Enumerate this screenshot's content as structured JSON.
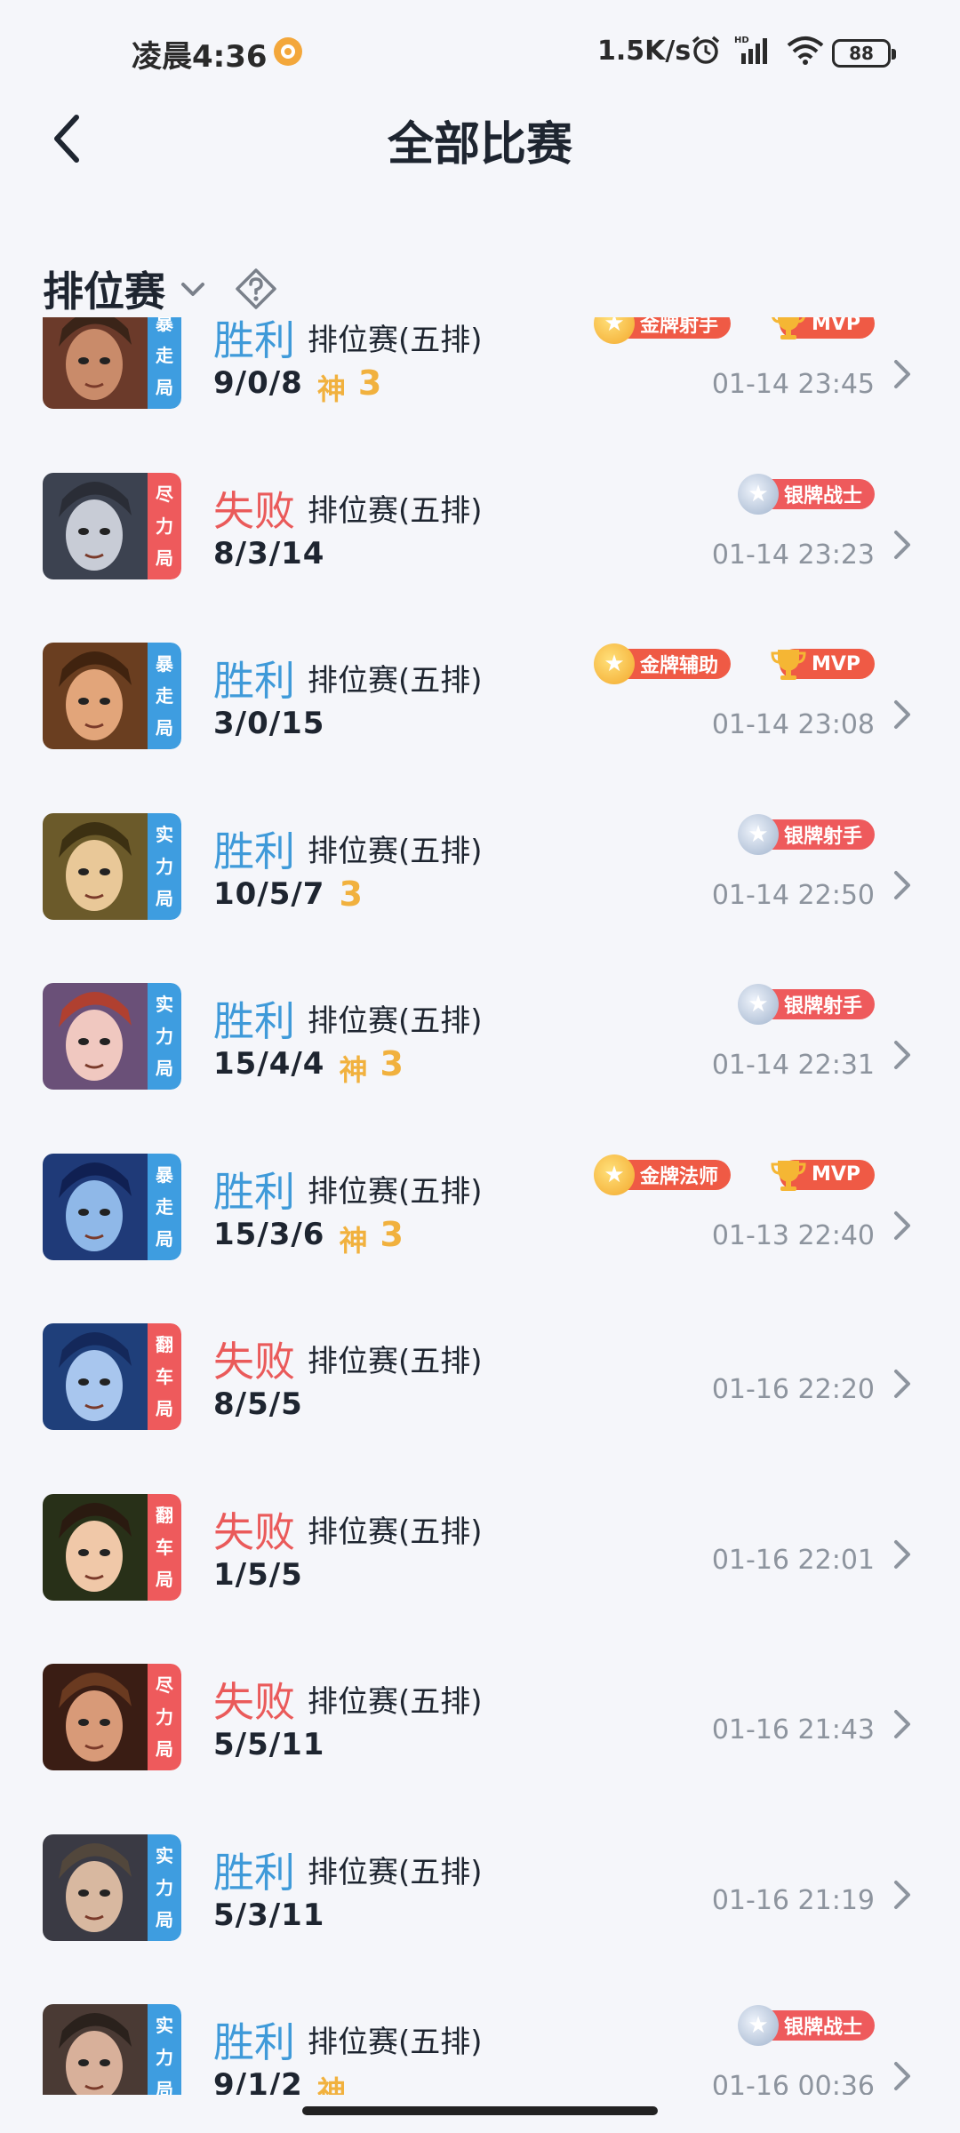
{
  "status_bar": {
    "time": "凌晨4:36",
    "net_speed": "1.5K/s",
    "battery": "88"
  },
  "header": {
    "title": "全部比赛"
  },
  "filter": {
    "label": "排位赛"
  },
  "matches": [
    {
      "result": "胜利",
      "outcome": "win",
      "mode": "排位赛(五排)",
      "kda": "9/0/8",
      "shen": "神",
      "three": "3",
      "time": "01-14 23:45",
      "tag": [
        "暴",
        "走",
        "局"
      ],
      "tag_color": "blue",
      "medal": "金牌射手",
      "medal_type": "gold",
      "mvp": "MVP"
    },
    {
      "result": "失败",
      "outcome": "lose",
      "mode": "排位赛(五排)",
      "kda": "8/3/14",
      "shen": "",
      "three": "",
      "time": "01-14 23:23",
      "tag": [
        "尽",
        "力",
        "局"
      ],
      "tag_color": "red",
      "medal": "银牌战士",
      "medal_type": "silver",
      "mvp": ""
    },
    {
      "result": "胜利",
      "outcome": "win",
      "mode": "排位赛(五排)",
      "kda": "3/0/15",
      "shen": "",
      "three": "",
      "time": "01-14 23:08",
      "tag": [
        "暴",
        "走",
        "局"
      ],
      "tag_color": "blue",
      "medal": "金牌辅助",
      "medal_type": "gold",
      "mvp": "MVP"
    },
    {
      "result": "胜利",
      "outcome": "win",
      "mode": "排位赛(五排)",
      "kda": "10/5/7",
      "shen": "",
      "three": "3",
      "time": "01-14 22:50",
      "tag": [
        "实",
        "力",
        "局"
      ],
      "tag_color": "blue",
      "medal": "银牌射手",
      "medal_type": "silver",
      "mvp": ""
    },
    {
      "result": "胜利",
      "outcome": "win",
      "mode": "排位赛(五排)",
      "kda": "15/4/4",
      "shen": "神",
      "three": "3",
      "time": "01-14 22:31",
      "tag": [
        "实",
        "力",
        "局"
      ],
      "tag_color": "blue",
      "medal": "银牌射手",
      "medal_type": "silver",
      "mvp": ""
    },
    {
      "result": "胜利",
      "outcome": "win",
      "mode": "排位赛(五排)",
      "kda": "15/3/6",
      "shen": "神",
      "three": "3",
      "time": "01-13 22:40",
      "tag": [
        "暴",
        "走",
        "局"
      ],
      "tag_color": "blue",
      "medal": "金牌法师",
      "medal_type": "gold",
      "mvp": "MVP"
    },
    {
      "result": "失败",
      "outcome": "lose",
      "mode": "排位赛(五排)",
      "kda": "8/5/5",
      "shen": "",
      "three": "",
      "time": "01-16 22:20",
      "tag": [
        "翻",
        "车",
        "局"
      ],
      "tag_color": "red",
      "medal": "",
      "medal_type": "",
      "mvp": ""
    },
    {
      "result": "失败",
      "outcome": "lose",
      "mode": "排位赛(五排)",
      "kda": "1/5/5",
      "shen": "",
      "three": "",
      "time": "01-16 22:01",
      "tag": [
        "翻",
        "车",
        "局"
      ],
      "tag_color": "red",
      "medal": "",
      "medal_type": "",
      "mvp": ""
    },
    {
      "result": "失败",
      "outcome": "lose",
      "mode": "排位赛(五排)",
      "kda": "5/5/11",
      "shen": "",
      "three": "",
      "time": "01-16 21:43",
      "tag": [
        "尽",
        "力",
        "局"
      ],
      "tag_color": "red",
      "medal": "",
      "medal_type": "",
      "mvp": ""
    },
    {
      "result": "胜利",
      "outcome": "win",
      "mode": "排位赛(五排)",
      "kda": "5/3/11",
      "shen": "",
      "three": "",
      "time": "01-16 21:19",
      "tag": [
        "实",
        "力",
        "局"
      ],
      "tag_color": "blue",
      "medal": "",
      "medal_type": "",
      "mvp": ""
    },
    {
      "result": "胜利",
      "outcome": "win",
      "mode": "排位赛(五排)",
      "kda": "9/1/2",
      "shen": "神",
      "three": "",
      "time": "01-16 00:36",
      "tag": [
        "实",
        "力",
        "局"
      ],
      "tag_color": "blue",
      "medal": "银牌战士",
      "medal_type": "silver",
      "mvp": ""
    }
  ]
}
